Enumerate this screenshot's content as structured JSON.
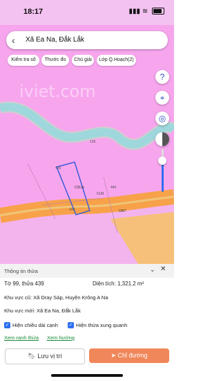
{
  "status": {
    "time": "18:17",
    "icons": "▮▮▮ ≋"
  },
  "search": {
    "back_icon": "back-arrow-icon",
    "text": "Xã Ea Na, Đắk Lắk"
  },
  "chips": [
    {
      "label": "Kiểm tra sổ"
    },
    {
      "label": "Thước đo"
    },
    {
      "label": "Chú giải"
    },
    {
      "label": "Lớp Q.Hoạch(2)"
    }
  ],
  "tools": {
    "help": "?",
    "compass": "⌖",
    "locate": "◎"
  },
  "watermark": "iviet.com",
  "map_labels": {
    "l1": "139",
    "l2": "436",
    "l3": "CDLN",
    "l4": "CLN",
    "l5": "440",
    "l6": "434",
    "l7": "ONT"
  },
  "sheet": {
    "title": "Thông tin thửa",
    "parcel": "Tờ 99, thửa 439",
    "area_label": "Diện tích:",
    "area_value": "1,321.2 m²",
    "old_area": "Khu vực cũ: Xã Dray Sáp, Huyện Krông A Na",
    "new_area": "Khu vực mới: Xã Ea Na, Đắk Lắk",
    "check1": "Hiện chiều dài cạnh",
    "check2": "Hiện thửa xung quanh",
    "link1": "Xem ranh thửa",
    "link2": "Xem hướng",
    "btn_save": "Lưu vị trí",
    "btn_dir": "Chỉ đường"
  },
  "colors": {
    "map_pink": "#f7a6ee",
    "road_orange": "#f7a24a",
    "river": "#9fd8dc",
    "primary": "#f0875a"
  }
}
